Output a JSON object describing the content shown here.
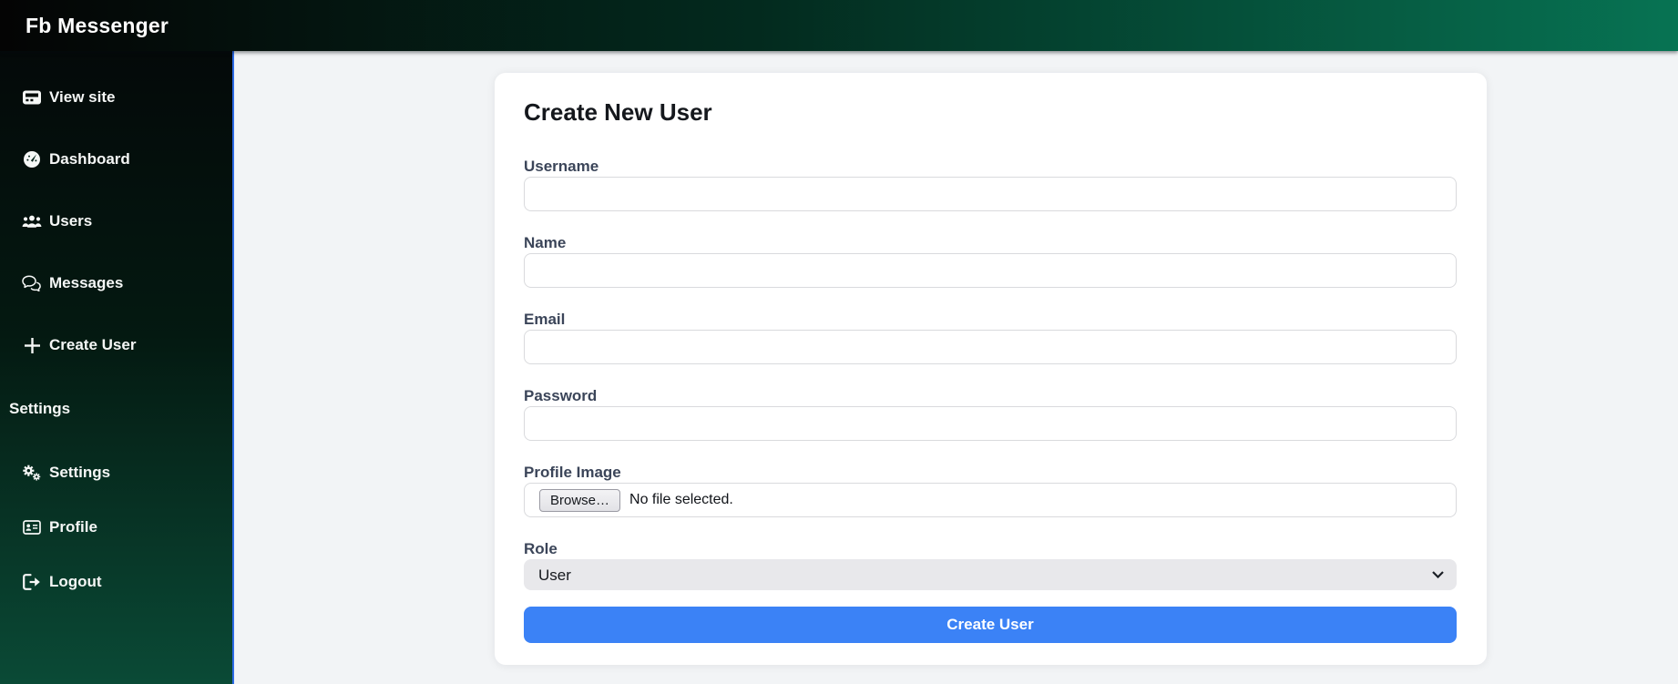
{
  "app": {
    "title": "Fb Messenger"
  },
  "colors": {
    "topbar_green": "#077353",
    "sidebar_green": "#0a4a36",
    "sidebar_accent_border": "#2e6be6",
    "button_blue": "#3b82f6",
    "card_bg": "#ffffff",
    "page_bg": "#f2f4f6"
  },
  "sidebar": {
    "items": [
      {
        "label": "View site",
        "icon": "pager-icon"
      },
      {
        "label": "Dashboard",
        "icon": "dashboard-icon"
      },
      {
        "label": "Users",
        "icon": "users-icon"
      },
      {
        "label": "Messages",
        "icon": "messages-icon"
      },
      {
        "label": "Create User",
        "icon": "plus-icon"
      }
    ],
    "section_header": "Settings",
    "settings_items": [
      {
        "label": "Settings",
        "icon": "gears-icon"
      },
      {
        "label": "Profile",
        "icon": "id-card-icon"
      },
      {
        "label": "Logout",
        "icon": "logout-icon"
      }
    ]
  },
  "form": {
    "title": "Create New User",
    "fields": [
      {
        "label": "Username",
        "value": "",
        "placeholder": ""
      },
      {
        "label": "Name",
        "value": "",
        "placeholder": ""
      },
      {
        "label": "Email",
        "value": "",
        "placeholder": ""
      },
      {
        "label": "Password",
        "value": "",
        "placeholder": ""
      }
    ],
    "file_field": {
      "label": "Profile Image",
      "browse_label": "Browse…",
      "status": "No file selected."
    },
    "role_field": {
      "label": "Role",
      "selected": "User"
    },
    "submit_label": "Create User"
  }
}
